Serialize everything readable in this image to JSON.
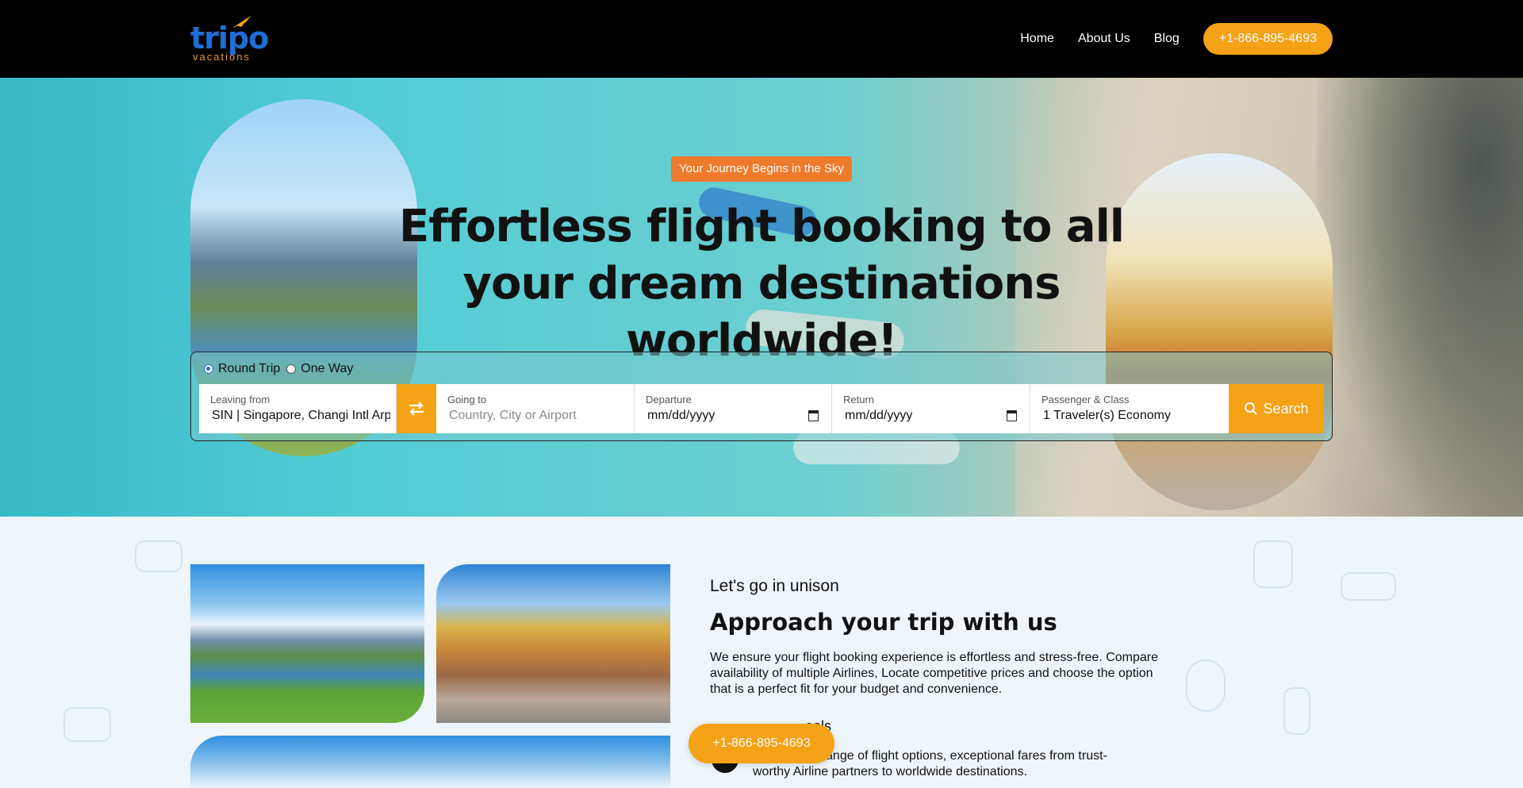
{
  "brand": {
    "name": "tripo",
    "tagline": "vacations"
  },
  "nav": {
    "items": [
      "Home",
      "About Us",
      "Blog"
    ],
    "phone": "+1-866-895-4693"
  },
  "hero": {
    "badge": "Your Journey Begins in the Sky",
    "title": "Effortless flight booking to all your dream destinations worldwide!"
  },
  "search": {
    "trip_types": [
      "Round Trip",
      "One Way"
    ],
    "selected_trip_type": "Round Trip",
    "leaving": {
      "label": "Leaving from",
      "value": "SIN | Singapore, Changi Intl Arp"
    },
    "going": {
      "label": "Going to",
      "placeholder": "Country, City or Airport"
    },
    "departure": {
      "label": "Departure",
      "value": "mm/dd/yyyy"
    },
    "return": {
      "label": "Return",
      "value": "mm/dd/yyyy"
    },
    "passenger": {
      "label": "Passenger & Class",
      "value": "1 Traveler(s) Economy"
    },
    "button": "Search"
  },
  "about": {
    "kicker": "Let's go in unison",
    "title": "Approach your trip with us",
    "paragraph": "We ensure your flight booking experience is effortless and stress-free. Compare availability of multiple Airlines, Locate competitive prices and choose the option that is a perfect fit for your budget and convenience.",
    "feature_title_visible": "eals",
    "feature_text_line1": "a wide range of flight options, exceptional fares from trust-",
    "feature_text_line2": "worthy Airline partners to worldwide destinations."
  },
  "floating_call": "+1-866-895-4693",
  "colors": {
    "accent": "#f5a216",
    "badge": "#f07a2c",
    "header": "#000000",
    "brand_blue": "#1d6fd6"
  }
}
